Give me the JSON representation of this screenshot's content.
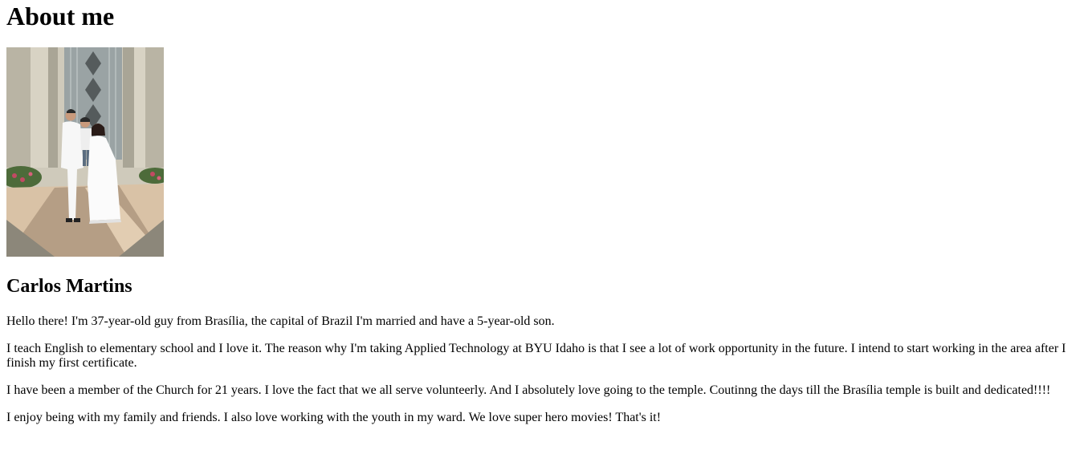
{
  "page": {
    "heading": "About me",
    "name": "Carlos Martins",
    "photo": {
      "icon": "family-photo-temple"
    },
    "paragraphs": [
      "Hello there! I'm 37-year-old guy from Brasília, the capital of Brazil I'm married and have a 5-year-old son.",
      "I teach English to elementary school and I love it. The reason why I'm taking Applied Technology at BYU Idaho is that I see a lot of work opportunity in the future. I intend to start working in the area after I finish my first certificate.",
      "I have been a member of the Church for 21 years. I love the fact that we all serve volunteerly. And I absolutely love going to the temple. Coutinng the days till the Brasília temple is built and dedicated!!!!",
      "I enjoy being with my family and friends. I also love working with the youth in my ward. We love super hero movies! That's it!"
    ]
  }
}
